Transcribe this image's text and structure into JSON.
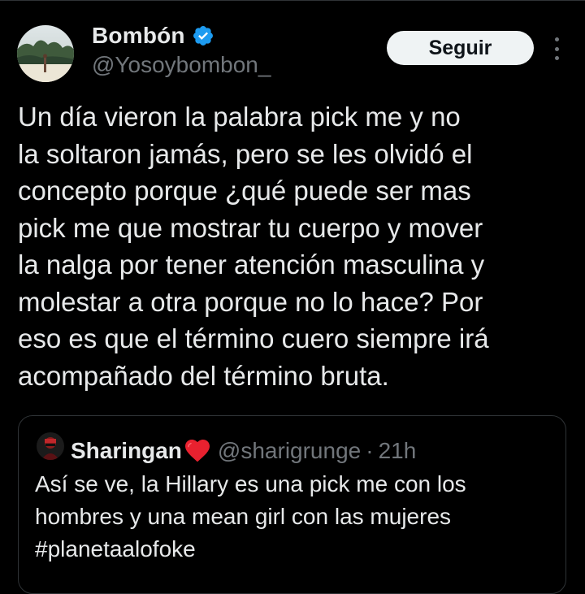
{
  "tweet": {
    "author": {
      "name": "Bombón",
      "handle": "@Yosoybombon_",
      "verified_icon": "verified-badge-icon"
    },
    "follow_label": "Seguir",
    "more_icon": "more-options-icon",
    "text_lines": [
      "Un día vieron la palabra pick me y no",
      "la soltaron jamás, pero se les olvidó el",
      "concepto porque ¿qué puede ser mas",
      "pick me que mostrar tu cuerpo y mover",
      "la nalga por tener atención masculina y",
      "molestar a otra porque no lo hace? Por",
      "eso es que el término cuero siempre irá",
      "acompañado del término bruta."
    ]
  },
  "quoted": {
    "name": "Sharingan",
    "name_emoji": "red-heart-icon",
    "handle": "@sharigrunge",
    "separator": "·",
    "time": "21h",
    "text_lines": [
      "Así se ve, la Hillary es una pick me con los",
      "hombres y una mean girl con las mujeres",
      "#planetaalofoke"
    ]
  },
  "colors": {
    "background": "#000000",
    "text": "#e7e9ea",
    "muted": "#71767b",
    "border": "#2f3336",
    "verified": "#1d9bf0",
    "button_bg": "#eff3f4",
    "heart": "#f91880"
  }
}
